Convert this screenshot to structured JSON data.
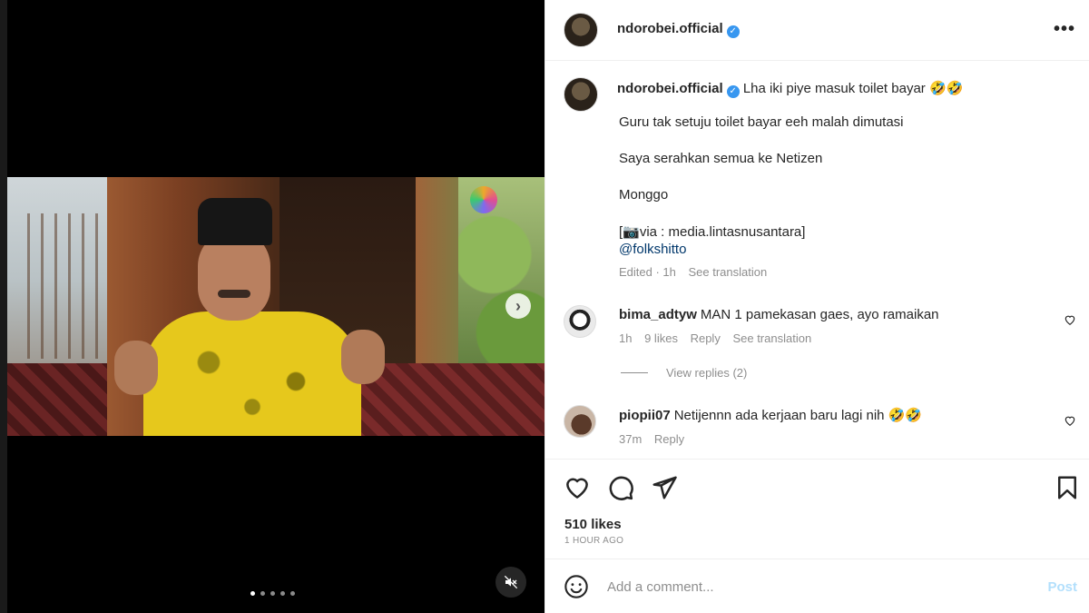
{
  "post": {
    "username": "ndorobei.official",
    "verified_glyph": "✓",
    "more_glyph": "•••",
    "caption_title": "Lha iki piye masuk toilet bayar 🤣🤣",
    "caption_lines": [
      "Guru tak setuju toilet bayar eeh malah dimutasi",
      "Saya serahkan semua ke Netizen",
      "Monggo",
      "[📷via : media.lintasnusantara]"
    ],
    "mention": "@folkshitto",
    "edited": "Edited · 1h",
    "see_translation": "See translation"
  },
  "comments": [
    {
      "user": "bima_adtyw",
      "text": "MAN 1 pamekasan gaes, ayo ramaikan",
      "time": "1h",
      "likes": "9 likes",
      "reply": "Reply",
      "see_translation": "See translation",
      "view_replies": "View replies (2)"
    },
    {
      "user": "piopii07",
      "text": "Netijennn ada kerjaan baru lagi nih 🤣🤣",
      "time": "37m",
      "reply": "Reply"
    }
  ],
  "actions": {
    "likes": "510 likes",
    "time_ago": "1 HOUR AGO",
    "icons": [
      "heart-icon",
      "comment-icon",
      "share-icon",
      "bookmark-icon"
    ]
  },
  "comment_box": {
    "placeholder": "Add a comment...",
    "post_label": "Post"
  },
  "media": {
    "carousel_total": 5,
    "carousel_index": 1,
    "next_glyph": "›"
  },
  "colors": {
    "link": "#00376b",
    "muted": "#8e8e8e",
    "verified": "#3897f0",
    "post_disabled": "#b2dffc"
  }
}
